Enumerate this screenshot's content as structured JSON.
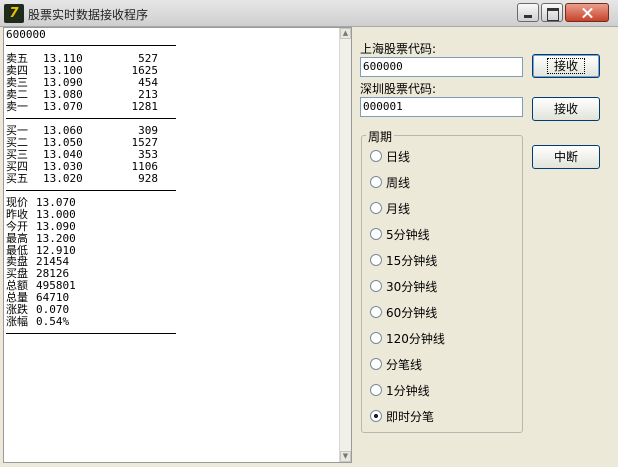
{
  "window": {
    "title": "股票实时数据接收程序",
    "icon_text": "7"
  },
  "quote": {
    "code": "600000",
    "asks": [
      {
        "label": "卖五",
        "price": "13.110",
        "volume": "527"
      },
      {
        "label": "卖四",
        "price": "13.100",
        "volume": "1625"
      },
      {
        "label": "卖三",
        "price": "13.090",
        "volume": "454"
      },
      {
        "label": "卖二",
        "price": "13.080",
        "volume": "213"
      },
      {
        "label": "卖一",
        "price": "13.070",
        "volume": "1281"
      }
    ],
    "bids": [
      {
        "label": "买一",
        "price": "13.060",
        "volume": "309"
      },
      {
        "label": "买二",
        "price": "13.050",
        "volume": "1527"
      },
      {
        "label": "买三",
        "price": "13.040",
        "volume": "353"
      },
      {
        "label": "买四",
        "price": "13.030",
        "volume": "1106"
      },
      {
        "label": "买五",
        "price": "13.020",
        "volume": "928"
      }
    ],
    "stats": [
      {
        "label": "现价",
        "value": "13.070"
      },
      {
        "label": "昨收",
        "value": "13.000"
      },
      {
        "label": "今开",
        "value": "13.090"
      },
      {
        "label": "最高",
        "value": "13.200"
      },
      {
        "label": "最低",
        "value": "12.910"
      },
      {
        "label": "卖盘",
        "value": "21454"
      },
      {
        "label": "买盘",
        "value": "28126"
      },
      {
        "label": "总额",
        "value": "495801"
      },
      {
        "label": "总量",
        "value": "64710"
      },
      {
        "label": "涨跌",
        "value": "0.070"
      },
      {
        "label": "涨幅",
        "value": "0.54%"
      }
    ]
  },
  "shanghai": {
    "label": "上海股票代码:",
    "value": "600000",
    "button": "接收"
  },
  "shenzhen": {
    "label": "深圳股票代码:",
    "value": "000001",
    "button": "接收"
  },
  "interrupt_button": "中断",
  "period": {
    "title": "周期",
    "options": [
      "日线",
      "周线",
      "月线",
      "5分钟线",
      "15分钟线",
      "30分钟线",
      "60分钟线",
      "120分钟线",
      "分笔线",
      "1分钟线",
      "即时分笔"
    ],
    "selected": "即时分笔"
  }
}
